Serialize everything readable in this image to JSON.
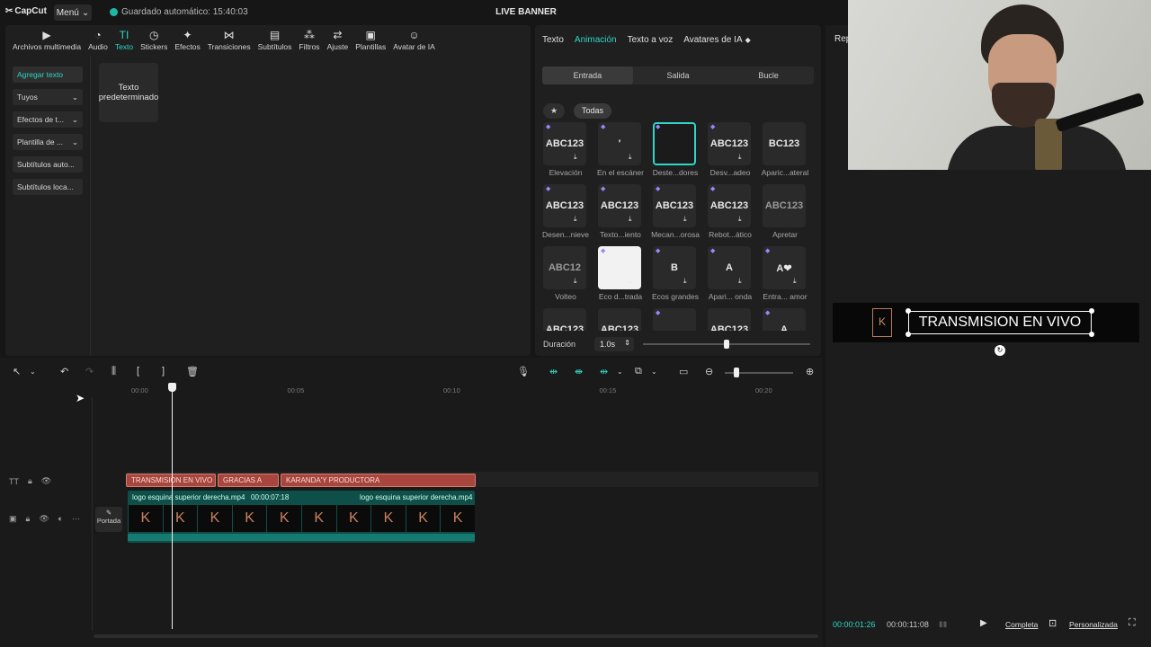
{
  "app": {
    "logo": "CapCut",
    "menu": "Menú",
    "autosave": "Guardado automático: 15:40:03",
    "project_title": "LIVE BANNER"
  },
  "toolbar": [
    {
      "label": "Archivos multimedia",
      "icon": "media-icon"
    },
    {
      "label": "Audio",
      "icon": "audio-icon"
    },
    {
      "label": "Texto",
      "icon": "text-icon",
      "active": true
    },
    {
      "label": "Stickers",
      "icon": "sticker-icon"
    },
    {
      "label": "Efectos",
      "icon": "effects-icon"
    },
    {
      "label": "Transiciones",
      "icon": "transition-icon"
    },
    {
      "label": "Subtítulos",
      "icon": "subtitles-icon"
    },
    {
      "label": "Filtros",
      "icon": "filters-icon"
    },
    {
      "label": "Ajuste",
      "icon": "adjust-icon"
    },
    {
      "label": "Plantillas",
      "icon": "templates-icon"
    },
    {
      "label": "Avatar de IA",
      "icon": "ai-avatar-icon"
    }
  ],
  "sidebar": {
    "items": [
      {
        "label": "Agregar texto",
        "active": true
      },
      {
        "label": "Tuyos"
      },
      {
        "label": "Efectos de t..."
      },
      {
        "label": "Plantilla de ..."
      },
      {
        "label": "Subtítulos auto..."
      },
      {
        "label": "Subtítulos loca..."
      }
    ]
  },
  "default_text_tile": "Texto predeterminado",
  "anim_panel": {
    "tabs": [
      {
        "label": "Texto"
      },
      {
        "label": "Animación",
        "active": true
      },
      {
        "label": "Texto a voz"
      },
      {
        "label": "Avatares de IA"
      }
    ],
    "segments": [
      "Entrada",
      "Salida",
      "Bucle"
    ],
    "filter_all": "Todas",
    "items": [
      {
        "thumb": "ABC123",
        "caption": "Elevación"
      },
      {
        "thumb": "'",
        "caption": "En el escáner"
      },
      {
        "thumb": "",
        "caption": "Deste...dores",
        "selected": true
      },
      {
        "thumb": "ABC123",
        "caption": "Desv...adeo"
      },
      {
        "thumb": "BC123",
        "caption": "Aparic...ateral"
      },
      {
        "thumb": "ABC123",
        "caption": "Desen...nieve"
      },
      {
        "thumb": "ABC123",
        "caption": "Texto...iento"
      },
      {
        "thumb": "ABC123",
        "caption": "Mecan...orosa"
      },
      {
        "thumb": "ABC123",
        "caption": "Rebot...ático"
      },
      {
        "thumb": "ABC123",
        "caption": "Apretar"
      },
      {
        "thumb": "ABC12",
        "caption": "Volteo"
      },
      {
        "thumb": "",
        "caption": "Eco d...trada"
      },
      {
        "thumb": "B",
        "caption": "Ecos grandes"
      },
      {
        "thumb": "A",
        "caption": "Apari... onda"
      },
      {
        "thumb": "A❤",
        "caption": "Entra... amor"
      },
      {
        "thumb": "ABC123",
        "caption": ""
      },
      {
        "thumb": "ABC123",
        "caption": ""
      },
      {
        "thumb": "",
        "caption": ""
      },
      {
        "thumb": "ABC123",
        "caption": ""
      },
      {
        "thumb": "A",
        "caption": ""
      }
    ],
    "duration_label": "Duración",
    "duration_value": "1.0s"
  },
  "player": {
    "rep_label": "Rep",
    "banner_text": "TRANSMISION EN VIVO",
    "time_current": "00:00:01:26",
    "time_total": "00:00:11:08",
    "complete_label": "Completa",
    "custom_label": "Personalizada"
  },
  "timeline": {
    "ruler": [
      "00:00",
      "00:05",
      "00:10",
      "00:15",
      "00:20"
    ],
    "text_clips": [
      "TRANSMISION EN VIVO",
      "GRACIAS A",
      "KARANDA'Y PRODUCTORA"
    ],
    "video_label_1": "logo esquina superior derecha.mp4",
    "video_duration": "00:00:07:18",
    "video_label_2": "logo esquina superior derecha.mp4",
    "cover_label": "Portada"
  },
  "colors": {
    "accent": "#2ed6c5",
    "text_clip": "#a8463d",
    "video_clip": "#0e4f49",
    "premium": "#9a86ff"
  }
}
